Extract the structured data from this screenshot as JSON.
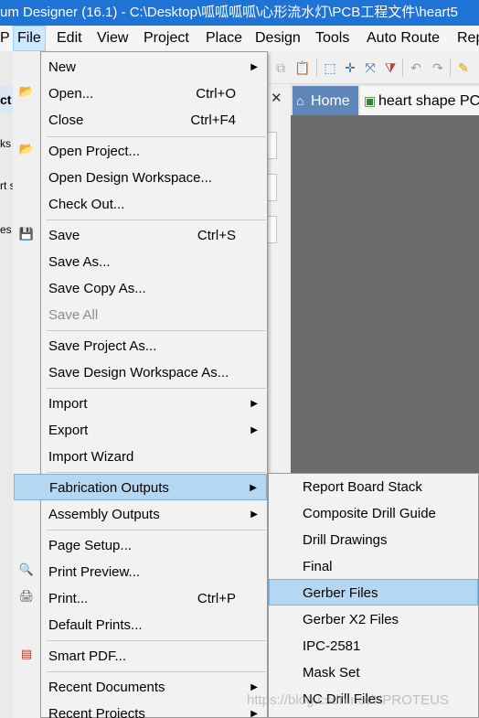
{
  "window": {
    "title": "um Designer (16.1) - C:\\Desktop\\呱呱呱呱\\心形流水灯\\PCB工程文件\\heart5"
  },
  "menubar": {
    "items": [
      {
        "label": "P"
      },
      {
        "label": "File"
      },
      {
        "label": "Edit"
      },
      {
        "label": "View"
      },
      {
        "label": "Project"
      },
      {
        "label": "Place"
      },
      {
        "label": "Design"
      },
      {
        "label": "Tools"
      },
      {
        "label": "Auto Route"
      },
      {
        "label": "Rep"
      }
    ]
  },
  "left_panel": {
    "title": "ct",
    "frag1": "ks",
    "frag2": "rt s",
    "frag3": "es"
  },
  "tabs": {
    "home": "Home",
    "pcb": "heart shape PCB"
  },
  "file_menu": {
    "items": [
      {
        "label": "New",
        "shortcut": "",
        "submenu": true
      },
      {
        "label": "Open...",
        "shortcut": "Ctrl+O"
      },
      {
        "label": "Close",
        "shortcut": "Ctrl+F4"
      },
      {
        "label": "Open Project..."
      },
      {
        "label": "Open Design Workspace..."
      },
      {
        "label": "Check Out..."
      },
      {
        "label": "Save",
        "shortcut": "Ctrl+S"
      },
      {
        "label": "Save As..."
      },
      {
        "label": "Save Copy As..."
      },
      {
        "label": "Save All",
        "disabled": true
      },
      {
        "label": "Save Project As..."
      },
      {
        "label": "Save Design Workspace As..."
      },
      {
        "label": "Import",
        "submenu": true
      },
      {
        "label": "Export",
        "submenu": true
      },
      {
        "label": "Import Wizard"
      },
      {
        "label": "Fabrication Outputs",
        "submenu": true,
        "highlighted": true
      },
      {
        "label": "Assembly Outputs",
        "submenu": true
      },
      {
        "label": "Page Setup..."
      },
      {
        "label": "Print Preview..."
      },
      {
        "label": "Print...",
        "shortcut": "Ctrl+P"
      },
      {
        "label": "Default Prints..."
      },
      {
        "label": "Smart PDF..."
      },
      {
        "label": "Recent Documents",
        "submenu": true
      },
      {
        "label": "Recent Projects",
        "submenu": true
      }
    ]
  },
  "fabrication_submenu": {
    "items": [
      {
        "label": "Report Board Stack"
      },
      {
        "label": "Composite Drill Guide"
      },
      {
        "label": "Drill Drawings"
      },
      {
        "label": "Final"
      },
      {
        "label": "Gerber Files",
        "highlighted": true
      },
      {
        "label": "Gerber X2 Files"
      },
      {
        "label": "IPC-2581"
      },
      {
        "label": "Mask Set"
      },
      {
        "label": "NC Drill Files"
      }
    ]
  },
  "watermark": "https://blog.csdn.net/KPROTEUS",
  "colors": {
    "titlebar": "#1f73d4",
    "highlight": "#b6d7f2",
    "workspace": "#6b6b6b",
    "home_tab": "#5f86b8"
  },
  "icons": {
    "arrow": "submenu-arrow",
    "open": "folder-open-icon",
    "save": "floppy-icon",
    "preview": "magnifier-icon",
    "print": "printer-icon",
    "pdf": "pdf-icon"
  }
}
